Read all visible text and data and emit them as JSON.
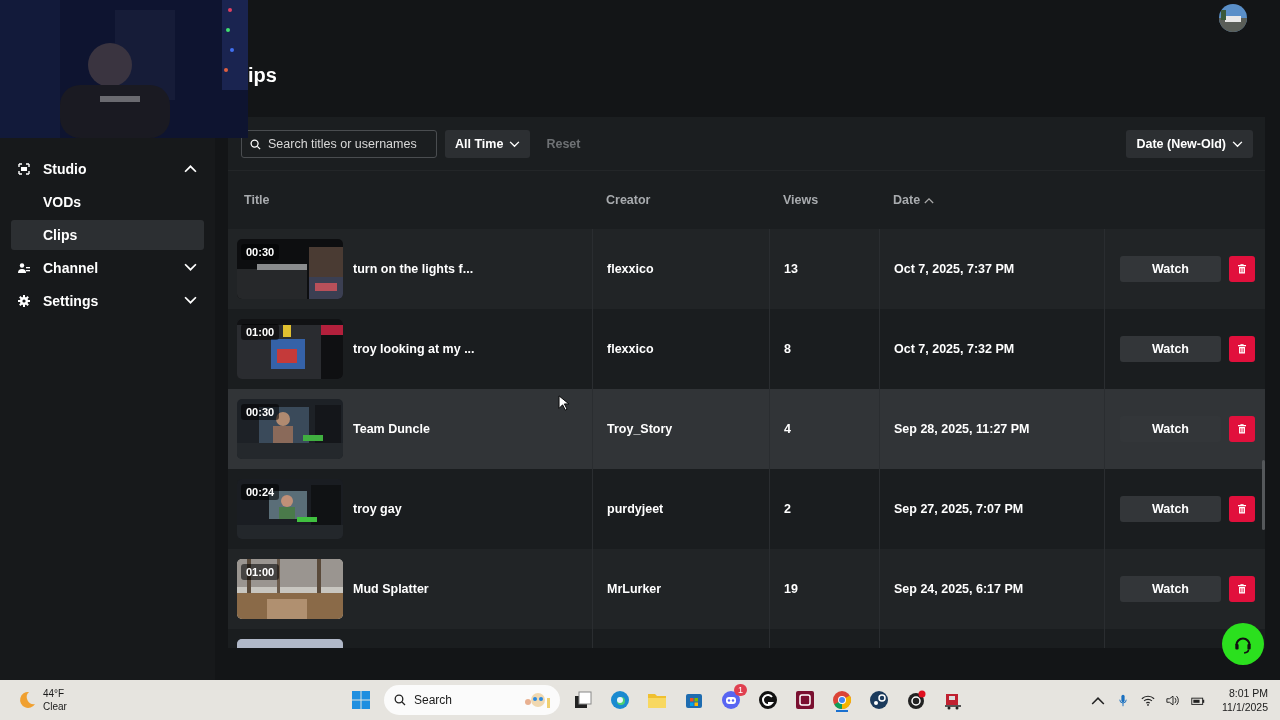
{
  "page_title": "ips",
  "sidebar": {
    "items": [
      {
        "label": "Studio",
        "expanded": true,
        "children": [
          {
            "label": "VODs",
            "selected": false
          },
          {
            "label": "Clips",
            "selected": true
          }
        ]
      },
      {
        "label": "Channel",
        "expanded": false
      },
      {
        "label": "Settings",
        "expanded": false
      }
    ]
  },
  "toolbar": {
    "search": {
      "placeholder": "Search titles or usernames"
    },
    "time_filter": "All Time",
    "reset": {
      "label": "Reset",
      "disabled": true
    },
    "sort": "Date (New-Old)"
  },
  "table": {
    "columns": [
      {
        "label": "Title",
        "sorted": false
      },
      {
        "label": "Creator",
        "sorted": false
      },
      {
        "label": "Views",
        "sorted": false
      },
      {
        "label": "Date",
        "sorted": true
      }
    ],
    "rows": [
      {
        "kind": "clip",
        "duration": "00:30",
        "title": "turn on the lights f...",
        "creator": "flexxico",
        "views": "13",
        "date": "Oct 7, 2025, 7:37 PM",
        "action": "Watch",
        "highlighted": false
      },
      {
        "kind": "clip",
        "duration": "01:00",
        "title": "troy looking at my ...",
        "creator": "flexxico",
        "views": "8",
        "date": "Oct 7, 2025, 7:32 PM",
        "action": "Watch",
        "highlighted": false
      },
      {
        "kind": "clip",
        "duration": "00:30",
        "title": "Team Duncle",
        "creator": "Troy_Story",
        "views": "4",
        "date": "Sep 28, 2025, 11:27 PM",
        "action": "Watch",
        "highlighted": true
      },
      {
        "kind": "clip",
        "duration": "00:24",
        "title": "troy gay",
        "creator": "purdyjeet",
        "views": "2",
        "date": "Sep 27, 2025, 7:07 PM",
        "action": "Watch",
        "highlighted": false
      },
      {
        "kind": "clip",
        "duration": "01:00",
        "title": "Mud Splatter",
        "creator": "MrLurker",
        "views": "19",
        "date": "Sep 24, 2025, 6:17 PM",
        "action": "Watch",
        "highlighted": false
      },
      {
        "kind": "cut-off"
      }
    ]
  },
  "taskbar": {
    "weather": {
      "temp": "44°F",
      "condition": "Clear"
    },
    "search": "Search",
    "badge": "1",
    "time": "8:01 PM",
    "date": "11/1/2025"
  }
}
